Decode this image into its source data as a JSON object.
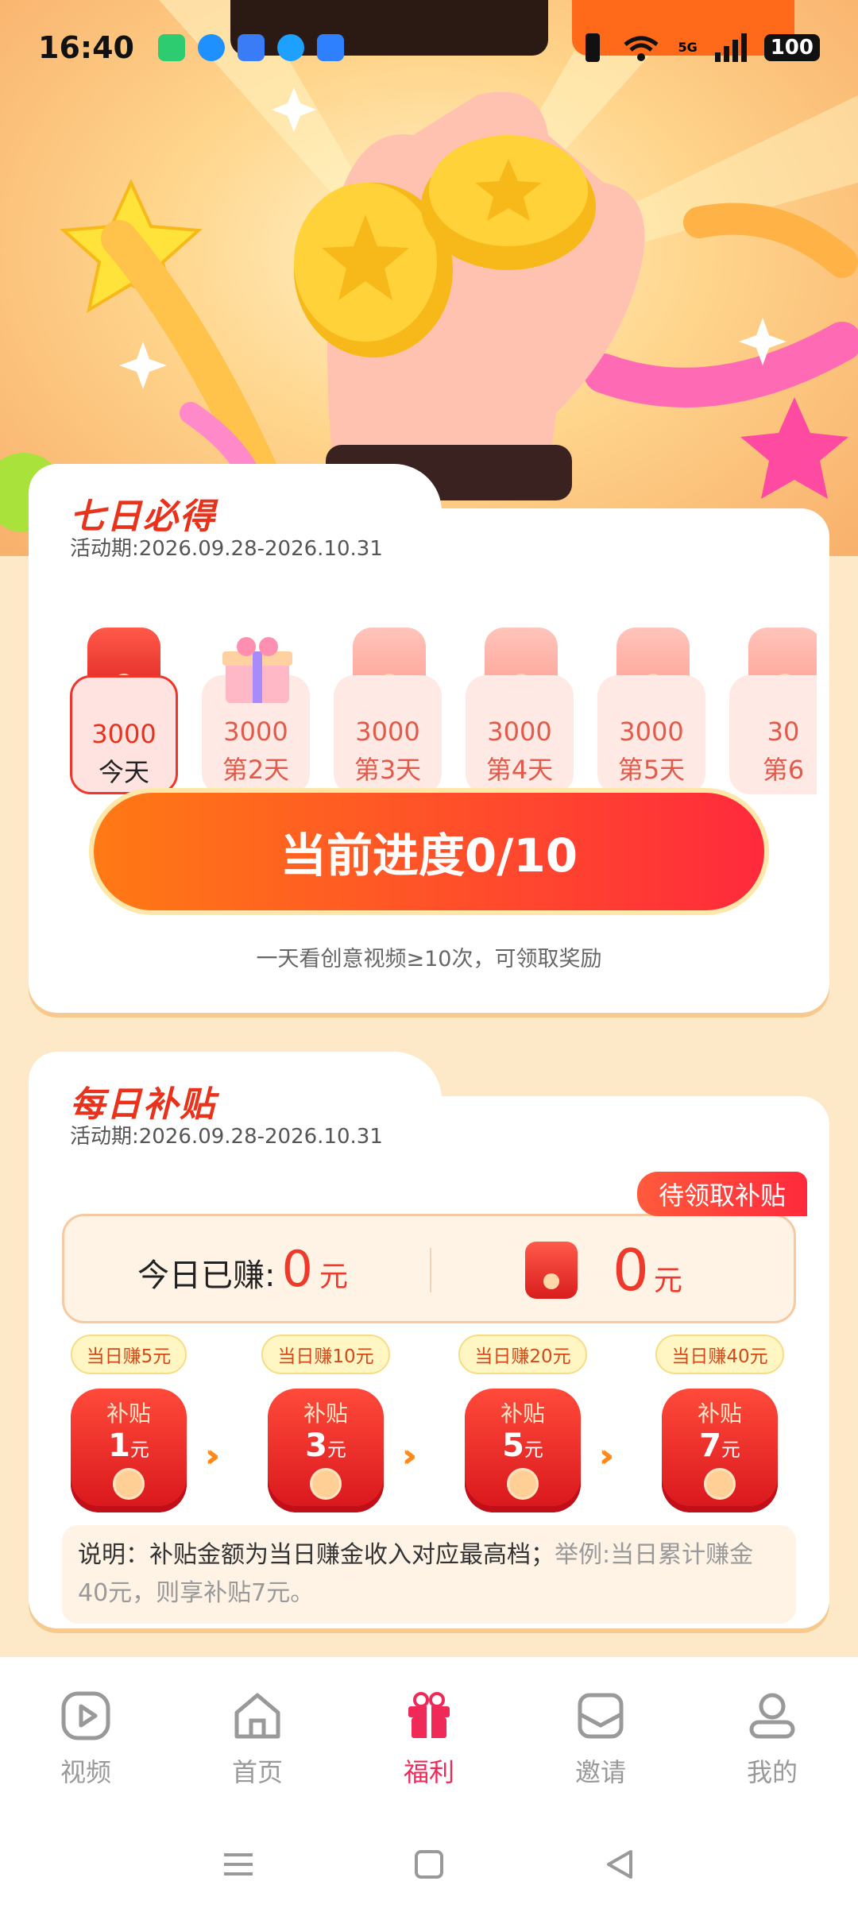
{
  "status_bar": {
    "time": "16:40",
    "network": "5G",
    "battery": "100"
  },
  "hero": {
    "banner_icon": "coin-hand-illustration"
  },
  "seven_day": {
    "title": "七日必得",
    "period": "活动期:2026.09.28-2026.10.31",
    "days": [
      {
        "amount": "3000",
        "label": "今天"
      },
      {
        "amount": "3000",
        "label": "第2天"
      },
      {
        "amount": "3000",
        "label": "第3天"
      },
      {
        "amount": "3000",
        "label": "第4天"
      },
      {
        "amount": "3000",
        "label": "第5天"
      },
      {
        "amount": "30",
        "label": "第6"
      }
    ],
    "progress_button": "当前进度0/10",
    "tip": "一天看创意视频≥10次，可领取奖励"
  },
  "daily_subsidy": {
    "title": "每日补贴",
    "period": "活动期:2026.09.28-2026.10.31",
    "pending_tag": "待领取补贴",
    "earned_label": "今日已赚:",
    "earned_value": "0",
    "earned_unit": "元",
    "pending_value": "0",
    "pending_unit": "元",
    "tiers": [
      {
        "label": "当日赚5元",
        "title": "补贴",
        "value": "1",
        "unit": "元"
      },
      {
        "label": "当日赚10元",
        "title": "补贴",
        "value": "3",
        "unit": "元"
      },
      {
        "label": "当日赚20元",
        "title": "补贴",
        "value": "5",
        "unit": "元"
      },
      {
        "label": "当日赚40元",
        "title": "补贴",
        "value": "7",
        "unit": "元"
      }
    ],
    "note_main": "说明：补贴金额为当日赚金收入对应最高档；",
    "note_example": "举例:当日累计赚金40元，则享补贴7元。"
  },
  "bottom_nav": {
    "items": [
      {
        "label": "视频",
        "icon": "play-icon"
      },
      {
        "label": "首页",
        "icon": "home-icon"
      },
      {
        "label": "福利",
        "icon": "gift-icon"
      },
      {
        "label": "邀请",
        "icon": "envelope-icon"
      },
      {
        "label": "我的",
        "icon": "person-icon"
      }
    ],
    "active": "福利"
  },
  "colors": {
    "accent": "#ef2a59",
    "red": "#e8321c",
    "button_gradient_start": "#ff7a14",
    "button_gradient_end": "#ff2a3c"
  }
}
